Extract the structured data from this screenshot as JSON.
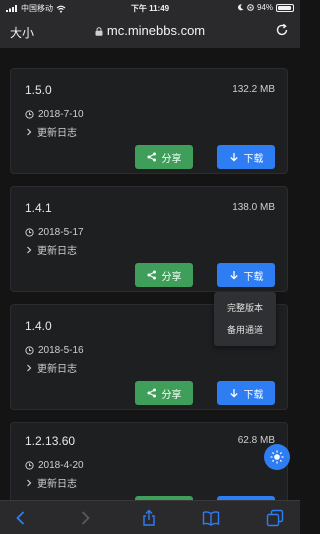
{
  "status_bar": {
    "carrier": "中国移动",
    "time": "下午 11:49",
    "battery": "94%"
  },
  "address_bar": {
    "text_size_label": "大小",
    "url": "mc.minebbs.com"
  },
  "releases": [
    {
      "version": "1.5.0",
      "size": "132.2 MB",
      "date": "2018-7-10",
      "changelog": "更新日志",
      "share": "分享",
      "download": "下载"
    },
    {
      "version": "1.4.1",
      "size": "138.0 MB",
      "date": "2018-5-17",
      "changelog": "更新日志",
      "share": "分享",
      "download": "下载"
    },
    {
      "version": "1.4.0",
      "size": "",
      "date": "2018-5-16",
      "changelog": "更新日志",
      "share": "分享",
      "download": "下载"
    },
    {
      "version": "1.2.13.60",
      "size": "62.8 MB",
      "date": "2018-4-20",
      "changelog": "更新日志",
      "share": "",
      "download": ""
    }
  ],
  "download_menu": {
    "items": [
      "完整版本",
      "备用通道"
    ]
  },
  "colors": {
    "share_green": "#3f9f5a",
    "download_blue": "#2f7df2",
    "card_bg": "#1e1f21"
  },
  "icons": {
    "toolbar": [
      "back-icon",
      "forward-icon",
      "share-icon",
      "bookmarks-icon",
      "tabs-icon"
    ]
  }
}
